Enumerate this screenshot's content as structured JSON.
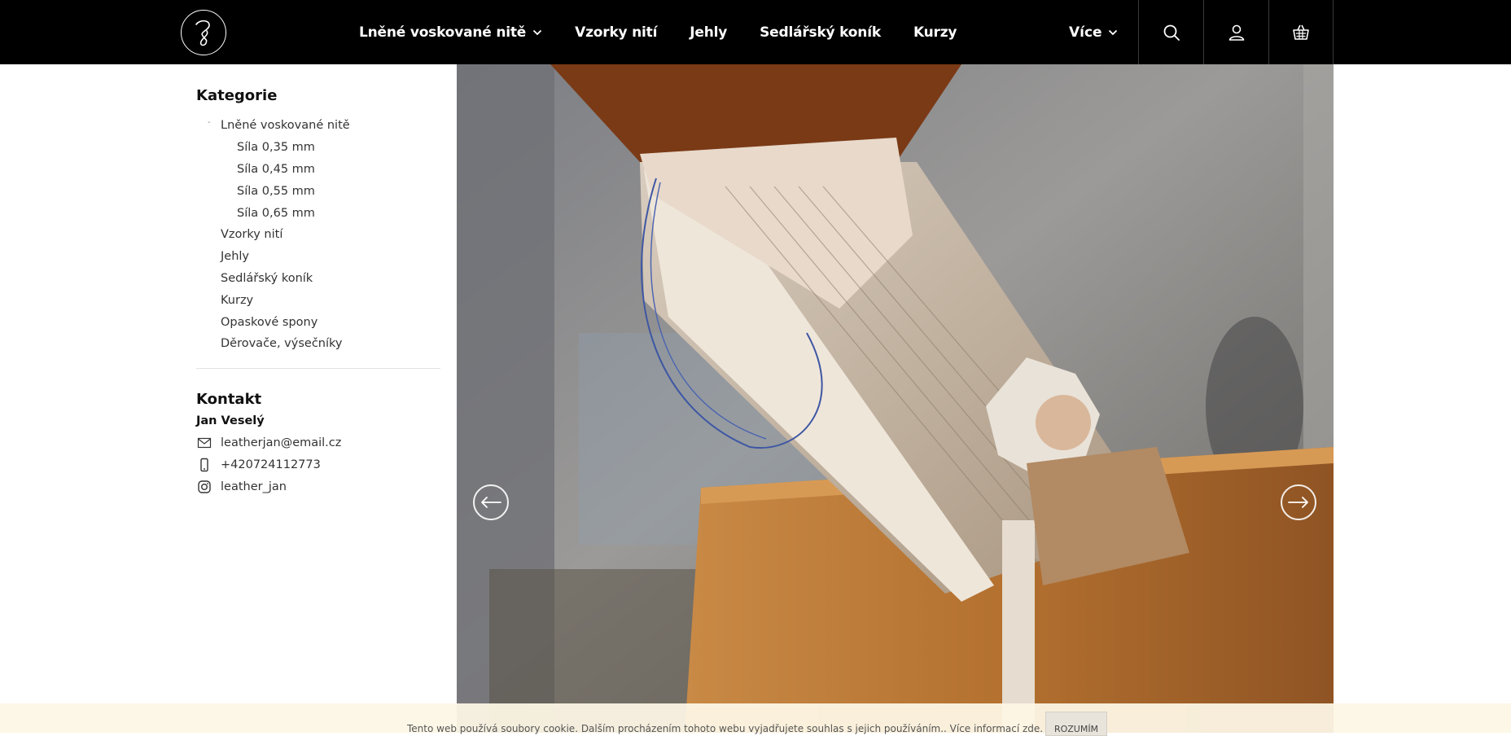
{
  "header": {
    "logo_icon": "script-j-logo",
    "nav": [
      {
        "label": "Lněné voskované nitě",
        "has_dropdown": true
      },
      {
        "label": "Vzorky nití",
        "has_dropdown": false
      },
      {
        "label": "Jehly",
        "has_dropdown": false
      },
      {
        "label": "Sedlářský koník",
        "has_dropdown": false
      },
      {
        "label": "Kurzy",
        "has_dropdown": false
      }
    ],
    "more_label": "Více",
    "icons": [
      "search-icon",
      "user-icon",
      "basket-icon"
    ]
  },
  "sidebar": {
    "categories_title": "Kategorie",
    "categories": [
      {
        "label": "Lněné voskované nitě",
        "level": 1,
        "open": true
      },
      {
        "label": "Síla 0,35 mm",
        "level": 2
      },
      {
        "label": "Síla 0,45 mm",
        "level": 2
      },
      {
        "label": "Síla 0,55 mm",
        "level": 2
      },
      {
        "label": "Síla 0,65 mm",
        "level": 2
      },
      {
        "label": "Vzorky nití",
        "level": 1
      },
      {
        "label": "Jehly",
        "level": 1
      },
      {
        "label": "Sedlářský koník",
        "level": 1
      },
      {
        "label": "Kurzy",
        "level": 1
      },
      {
        "label": "Opaskové spony",
        "level": 1
      },
      {
        "label": "Děrovače, výsečníky",
        "level": 1
      }
    ],
    "contact_title": "Kontakt",
    "contact_name": "Jan Veselý",
    "email": "leatherjan@email.cz",
    "phone": "+420724112773",
    "instagram": "leather_jan"
  },
  "hero": {
    "prev_icon": "arrow-left-icon",
    "next_icon": "arrow-right-icon"
  },
  "cookie": {
    "text": "Tento web používá soubory cookie. Dalším procházením tohoto webu vyjadřujete souhlas s jejich používáním.. Více informací zde.",
    "button": "ROZUMÍM"
  },
  "colors": {
    "header_bg": "#000000",
    "cookie_bg": "#fdf6e6",
    "wood": "#b8742f",
    "leather": "#7a3a16"
  }
}
